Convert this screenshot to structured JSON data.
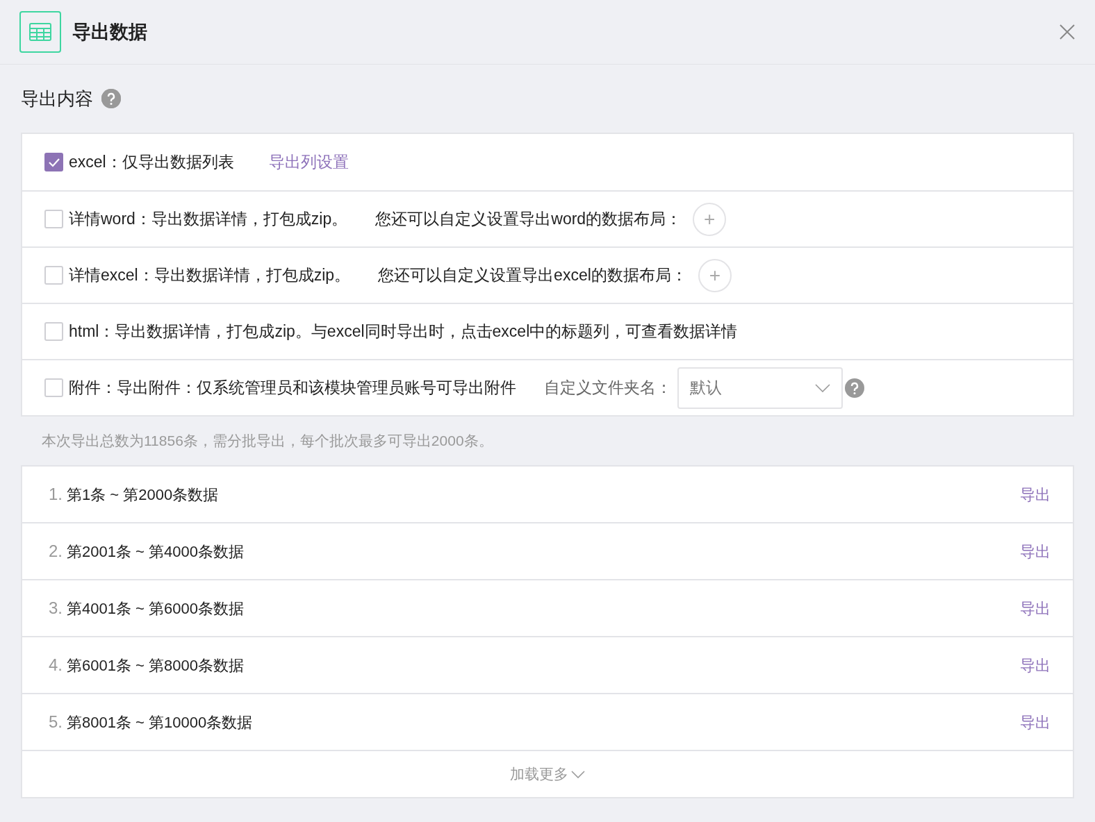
{
  "window": {
    "title": "导出数据"
  },
  "section": {
    "title": "导出内容"
  },
  "options": [
    {
      "kind": "link",
      "checked": true,
      "text": "excel：仅导出数据列表",
      "link": "导出列设置"
    },
    {
      "kind": "layout",
      "checked": false,
      "text": "详情word：导出数据详情，打包成zip。",
      "hint": "您还可以自定义设置导出word的数据布局：",
      "button": "+"
    },
    {
      "kind": "layout",
      "checked": false,
      "text": "详情excel：导出数据详情，打包成zip。",
      "hint": "您还可以自定义设置导出excel的数据布局：",
      "button": "+"
    },
    {
      "kind": "plain",
      "checked": false,
      "text": "html：导出数据详情，打包成zip。与excel同时导出时，点击excel中的标题列，可查看数据详情"
    },
    {
      "kind": "folder",
      "checked": false,
      "text": "附件：导出附件：仅系统管理员和该模块管理员账号可导出附件",
      "hint": "自定义文件夹名：",
      "value": "默认"
    }
  ],
  "note": "本次导出总数为11856条，需分批导出，每个批次最多可导出2000条。",
  "batches": [
    {
      "index": "1.",
      "range": "第1条 ~ 第2000条数据",
      "action": "导出"
    },
    {
      "index": "2.",
      "range": "第2001条 ~ 第4000条数据",
      "action": "导出"
    },
    {
      "index": "3.",
      "range": "第4001条 ~ 第6000条数据",
      "action": "导出"
    },
    {
      "index": "4.",
      "range": "第6001条 ~ 第8000条数据",
      "action": "导出"
    },
    {
      "index": "5.",
      "range": "第8001条 ~ 第10000条数据",
      "action": "导出"
    }
  ],
  "load_more": "加载更多"
}
